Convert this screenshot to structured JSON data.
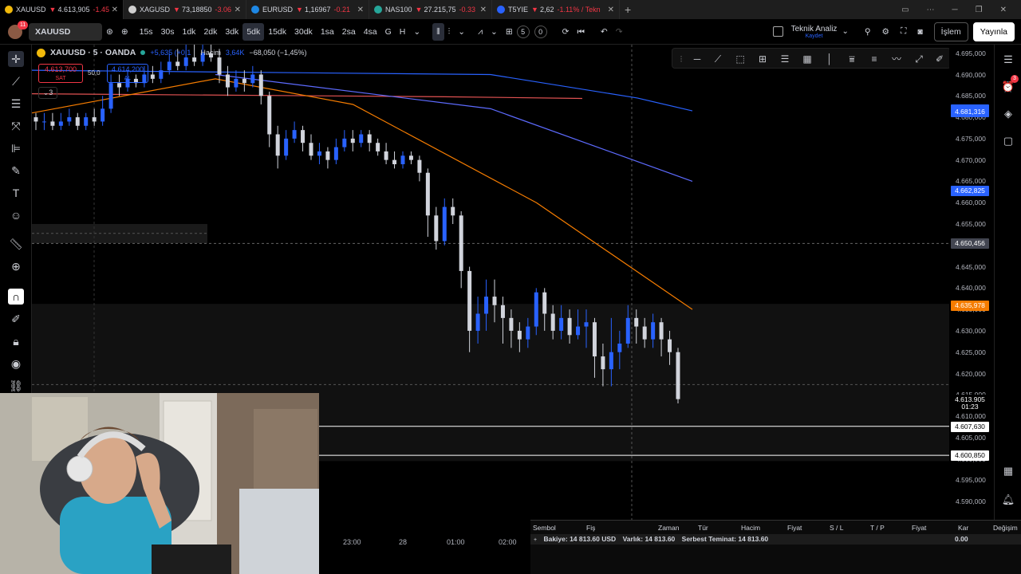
{
  "tabs": [
    {
      "symbol": "XAUUSD",
      "price": "4.613,905",
      "change": "-1.45",
      "color": "#f0b90b",
      "active": true
    },
    {
      "symbol": "XAGUSD",
      "price": "73,18850",
      "change": "-3.06",
      "color": "#cfcfcf",
      "active": false
    },
    {
      "symbol": "EURUSD",
      "price": "1,16967",
      "change": "-0.21",
      "color": "#1e88e5",
      "active": false
    },
    {
      "symbol": "NAS100",
      "price": "27.215,75",
      "change": "-0.33",
      "color": "#26a69a",
      "active": false
    },
    {
      "symbol": "T5YIE",
      "price": "2,62",
      "change": "-1.11% / Tekn",
      "color": "#2962ff",
      "active": false
    }
  ],
  "toolbar": {
    "notif_count": "11",
    "symbol": "XAUUSD",
    "intervals": [
      "15s",
      "30s",
      "1dk",
      "2dk",
      "3dk",
      "5dk",
      "15dk",
      "30dk",
      "1sa",
      "2sa",
      "4sa",
      "G",
      "H"
    ],
    "selected_interval": "5dk",
    "layout_count": "5",
    "layout_zero": "0",
    "analysis_title": "Teknik Analiz",
    "analysis_sub": "Kaydet",
    "trade_label": "İşlem",
    "publish_label": "Yayınla"
  },
  "legend": {
    "title": "XAUUSD · 5 · OANDA",
    "change": "+5,635 (+0,1",
    "volume_label": "Hacim",
    "volume": "3,64K",
    "vol_change": "−68,050 (−1,45%)",
    "sell_price": "4.613,700",
    "sell_label": "SAT",
    "spread": "50,0",
    "buy_price": "4.614,200",
    "buy_label": "AL",
    "layers": "3"
  },
  "price_axis": {
    "ticks": [
      "4.695,000",
      "4.690,000",
      "4.685,000",
      "4.680,000",
      "4.675,000",
      "4.670,000",
      "4.665,000",
      "4.660,000",
      "4.655,000",
      "4.650,000",
      "4.645,000",
      "4.640,000",
      "4.635,000",
      "4.630,000",
      "4.625,000",
      "4.620,000",
      "4.615,000",
      "4.610,000",
      "4.605,000",
      "4.600,000",
      "4.595,000",
      "4.590,000",
      "4.585,000"
    ],
    "labels": [
      {
        "text": "4.681,955",
        "color": "#2962ff"
      },
      {
        "text": "4.681,316",
        "color": "#2962ff"
      },
      {
        "text": "4.662,825",
        "color": "#2962ff"
      },
      {
        "text": "4.650,456",
        "color": "#434651"
      },
      {
        "text": "4.635,978",
        "color": "#f57c00"
      },
      {
        "text": "4.613,905",
        "color": "#000000"
      },
      {
        "text": "01:23",
        "color": "#000000"
      },
      {
        "text": "4.607,630",
        "color": "#ffffff"
      },
      {
        "text": "4.600,850",
        "color": "#ffffff"
      }
    ]
  },
  "time_axis": [
    "23:00",
    "28",
    "01:00",
    "02:00"
  ],
  "positions": {
    "headers": [
      "Sembol",
      "Fiş",
      "Zaman",
      "Tür",
      "Hacim",
      "Fiyat",
      "S / L",
      "T / P",
      "Fiyat",
      "Kar",
      "Değişim"
    ],
    "balance": "Bakiye: 14 813.60 USD",
    "equity": "Varlık: 14 813.60",
    "free_margin": "Serbest Teminat: 14 813.60",
    "profit": "0.00"
  },
  "chart_data": {
    "type": "candlestick",
    "title": "XAUUSD · 5 · OANDA",
    "ylim": [
      4585,
      4697
    ],
    "x_labels": [
      "23:00",
      "28",
      "01:00",
      "02:00"
    ],
    "last_price": 4613.905,
    "candles": [
      [
        4680,
        4679,
        4681,
        4677
      ],
      [
        4679,
        4679,
        4681,
        4677
      ],
      [
        4679,
        4678,
        4681,
        4677
      ],
      [
        4678,
        4679,
        4681,
        4677
      ],
      [
        4679,
        4680,
        4682,
        4678
      ],
      [
        4680,
        4678,
        4681,
        4677
      ],
      [
        4678,
        4680,
        4681,
        4677
      ],
      [
        4680,
        4679,
        4682,
        4678
      ],
      [
        4679,
        4682,
        4685,
        4678
      ],
      [
        4682,
        4688,
        4690,
        4681
      ],
      [
        4688,
        4687,
        4690,
        4685
      ],
      [
        4687,
        4689,
        4691,
        4686
      ],
      [
        4689,
        4688,
        4690,
        4687
      ],
      [
        4688,
        4690,
        4692,
        4687
      ],
      [
        4690,
        4689,
        4692,
        4688
      ],
      [
        4689,
        4691,
        4693,
        4688
      ],
      [
        4691,
        4693,
        4695,
        4690
      ],
      [
        4693,
        4692,
        4696,
        4691
      ],
      [
        4692,
        4694,
        4697,
        4691
      ],
      [
        4694,
        4693,
        4697,
        4692
      ],
      [
        4693,
        4695,
        4697,
        4692
      ],
      [
        4695,
        4694,
        4697,
        4693
      ],
      [
        4694,
        4690,
        4696,
        4688
      ],
      [
        4690,
        4687,
        4692,
        4685
      ],
      [
        4687,
        4689,
        4691,
        4686
      ],
      [
        4689,
        4688,
        4691,
        4686
      ],
      [
        4688,
        4690,
        4692,
        4687
      ],
      [
        4690,
        4685,
        4691,
        4683
      ],
      [
        4685,
        4676,
        4686,
        4673
      ],
      [
        4676,
        4671,
        4678,
        4668
      ],
      [
        4671,
        4675,
        4677,
        4670
      ],
      [
        4675,
        4677,
        4679,
        4674
      ],
      [
        4677,
        4674,
        4678,
        4672
      ],
      [
        4674,
        4671,
        4676,
        4670
      ],
      [
        4671,
        4672,
        4674,
        4669
      ],
      [
        4672,
        4670,
        4673,
        4668
      ],
      [
        4670,
        4673,
        4675,
        4669
      ],
      [
        4673,
        4675,
        4677,
        4672
      ],
      [
        4675,
        4674,
        4677,
        4672
      ],
      [
        4674,
        4676,
        4677,
        4673
      ],
      [
        4676,
        4674,
        4677,
        4672
      ],
      [
        4674,
        4672,
        4675,
        4671
      ],
      [
        4672,
        4670,
        4674,
        4669
      ],
      [
        4670,
        4669,
        4672,
        4668
      ],
      [
        4669,
        4671,
        4672,
        4668
      ],
      [
        4671,
        4670,
        4672,
        4669
      ],
      [
        4670,
        4667,
        4671,
        4665
      ],
      [
        4667,
        4657,
        4668,
        4652
      ],
      [
        4657,
        4651,
        4659,
        4649
      ],
      [
        4651,
        4659,
        4661,
        4650
      ],
      [
        4659,
        4657,
        4661,
        4655
      ],
      [
        4657,
        4644,
        4658,
        4640
      ],
      [
        4644,
        4630,
        4645,
        4625
      ],
      [
        4630,
        4634,
        4638,
        4627
      ],
      [
        4634,
        4638,
        4642,
        4630
      ],
      [
        4638,
        4636,
        4642,
        4632
      ],
      [
        4636,
        4633,
        4638,
        4627
      ],
      [
        4633,
        4630,
        4635,
        4626
      ],
      [
        4630,
        4628,
        4632,
        4625
      ],
      [
        4628,
        4631,
        4633,
        4626
      ],
      [
        4631,
        4639,
        4640,
        4629
      ],
      [
        4639,
        4634,
        4640,
        4630
      ],
      [
        4634,
        4630,
        4636,
        4628
      ],
      [
        4630,
        4633,
        4636,
        4628
      ],
      [
        4633,
        4629,
        4635,
        4627
      ],
      [
        4629,
        4631,
        4635,
        4628
      ],
      [
        4631,
        4632,
        4635,
        4626
      ],
      [
        4632,
        4624,
        4633,
        4619
      ],
      [
        4624,
        4621,
        4627,
        4617
      ],
      [
        4621,
        4625,
        4633,
        4617
      ],
      [
        4625,
        4627,
        4630,
        4621
      ],
      [
        4627,
        4633,
        4636,
        4626
      ],
      [
        4633,
        4631,
        4635,
        4627
      ],
      [
        4631,
        4628,
        4633,
        4626
      ],
      [
        4628,
        4632,
        4634,
        4626
      ],
      [
        4632,
        4628,
        4633,
        4624
      ],
      [
        4628,
        4625,
        4630,
        4622
      ],
      [
        4625,
        4614,
        4626,
        4613
      ]
    ],
    "moving_averages": [
      {
        "color": "#e05252",
        "values": [
          [
            0,
            4685.5
          ],
          [
            0.45,
            4684.8
          ],
          [
            0.6,
            4684.4
          ]
        ]
      },
      {
        "color": "#2962ff",
        "values": [
          [
            0,
            4691
          ],
          [
            0.5,
            4690
          ],
          [
            0.66,
            4684.5
          ],
          [
            0.72,
            4681.5
          ]
        ]
      },
      {
        "color": "#5d6bff",
        "values": [
          [
            0.2,
            4690
          ],
          [
            0.5,
            4682
          ],
          [
            0.72,
            4665
          ]
        ]
      },
      {
        "color": "#f57c00",
        "values": [
          [
            0,
            4681
          ],
          [
            0.2,
            4689
          ],
          [
            0.35,
            4683
          ],
          [
            0.55,
            4660
          ],
          [
            0.72,
            4635
          ]
        ]
      }
    ],
    "horizontal_lines": [
      4607.63,
      4600.85,
      4650.456
    ]
  }
}
